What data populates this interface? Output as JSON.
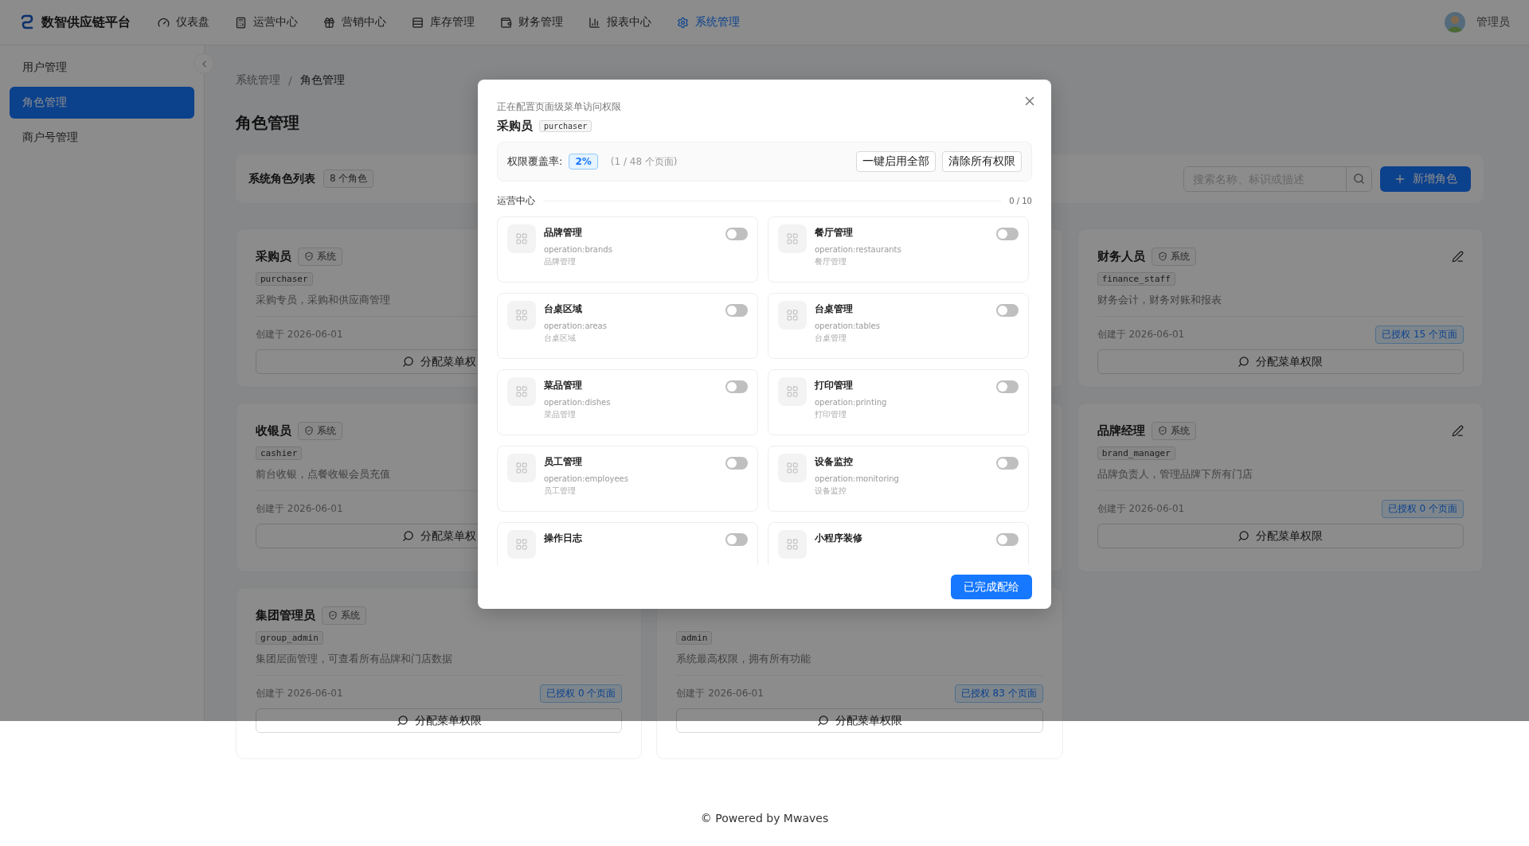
{
  "header": {
    "brand": "数智供应链平台",
    "nav": [
      {
        "label": "仪表盘",
        "selected": false
      },
      {
        "label": "运营中心",
        "selected": false
      },
      {
        "label": "营销中心",
        "selected": false
      },
      {
        "label": "库存管理",
        "selected": false
      },
      {
        "label": "财务管理",
        "selected": false
      },
      {
        "label": "报表中心",
        "selected": false
      },
      {
        "label": "系统管理",
        "selected": true
      }
    ],
    "user": "管理员"
  },
  "sidebar": {
    "items": [
      {
        "label": "用户管理",
        "selected": false
      },
      {
        "label": "角色管理",
        "selected": true
      },
      {
        "label": "商户号管理",
        "selected": false
      }
    ]
  },
  "breadcrumb": {
    "separator": "/",
    "items": [
      "系统管理",
      "角色管理"
    ]
  },
  "page_title": "角色管理",
  "toolbar": {
    "title": "系统角色列表",
    "count": "8 个角色",
    "search": {
      "placeholder": "搜索名称、标识或描述"
    },
    "add_button": "新增角色"
  },
  "cards": [
    {
      "kind": "role",
      "name": "采购员",
      "tag": "系统",
      "code": "purchaser",
      "description": "采购专员，采购和供应商管理",
      "created": "创建于 2026-06-01",
      "assign_button": "分配菜单权"
    },
    {
      "kind": "covered"
    },
    {
      "kind": "role",
      "name": "财务人员",
      "tag": "系统",
      "code": "finance_staff",
      "description": "财务会计，财务对账和报表",
      "created": "创建于 2026-06-01",
      "pages_badge": "已授权 15 个页面",
      "assign_button": "分配菜单权限",
      "editable": true
    },
    {
      "kind": "role",
      "name": "收银员",
      "tag": "系统",
      "code": "cashier",
      "description": "前台收银，点餐收银会员充值",
      "created": "创建于 2026-06-01",
      "assign_button": "分配菜单权"
    },
    {
      "kind": "covered"
    },
    {
      "kind": "role",
      "name": "品牌经理",
      "tag": "系统",
      "code": "brand_manager",
      "description": "品牌负责人，管理品牌下所有门店",
      "created": "创建于 2026-06-01",
      "pages_badge": "已授权 0 个页面",
      "assign_button": "分配菜单权限",
      "editable": true
    },
    {
      "kind": "role",
      "name": "集团管理员",
      "tag": "系统",
      "code": "group_admin",
      "description": "集团层面管理，可查看所有品牌和门店数据",
      "created": "创建于 2026-06-01",
      "pages_badge": "已授权 0 个页面",
      "assign_button": "分配菜单权限"
    },
    {
      "kind": "role",
      "code": "admin",
      "description": "系统最高权限，拥有所有功能",
      "created": "创建于 2026-06-01",
      "pages_badge": "已授权 83 个页面",
      "assign_button": "分配菜单权限"
    }
  ],
  "dialog": {
    "subtitle": "正在配置页面级菜单访问权限",
    "role_name": "采购员",
    "role_code": "purchaser",
    "coverage_label": "权限覆盖率:",
    "coverage_value": "2%",
    "coverage_detail": "(1 / 48 个页面)",
    "enable_all": "一键启用全部",
    "clear_all": "清除所有权限",
    "section": {
      "title": "运营中心",
      "count": "0 / 10"
    },
    "items": [
      {
        "name": "品牌管理",
        "code": "operation:brands",
        "description": "品牌管理",
        "on": false
      },
      {
        "name": "餐厅管理",
        "code": "operation:restaurants",
        "description": "餐厅管理",
        "on": false
      },
      {
        "name": "台桌区域",
        "code": "operation:areas",
        "description": "台桌区域",
        "on": false
      },
      {
        "name": "台桌管理",
        "code": "operation:tables",
        "description": "台桌管理",
        "on": false
      },
      {
        "name": "菜品管理",
        "code": "operation:dishes",
        "description": "菜品管理",
        "on": false
      },
      {
        "name": "打印管理",
        "code": "operation:printing",
        "description": "打印管理",
        "on": false
      },
      {
        "name": "员工管理",
        "code": "operation:employees",
        "description": "员工管理",
        "on": false
      },
      {
        "name": "设备监控",
        "code": "operation:monitoring",
        "description": "设备监控",
        "on": false
      },
      {
        "name": "操作日志",
        "on": false
      },
      {
        "name": "小程序装修",
        "on": false
      }
    ],
    "done_button": "已完成配给"
  },
  "footer": "© Powered by Mwaves"
}
